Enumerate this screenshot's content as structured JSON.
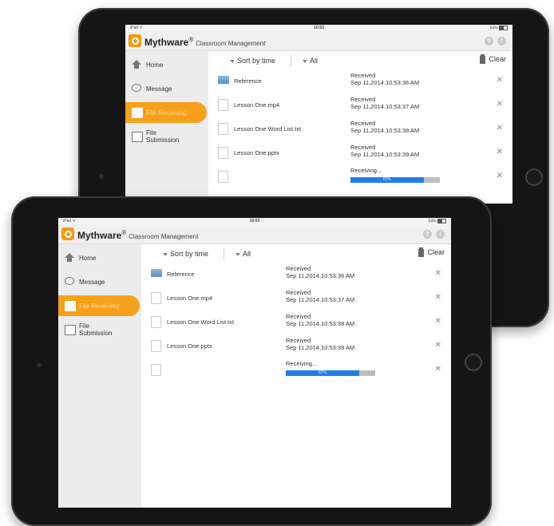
{
  "status_bar": {
    "device": "iPad ᯤ",
    "time": "10:53",
    "battery": "54%"
  },
  "app": {
    "brand": "Mythware",
    "registered": "®",
    "subtitle": "Classroom Management"
  },
  "sidebar": {
    "items": [
      {
        "label": "Home",
        "icon": "house-icon"
      },
      {
        "label": "Message",
        "icon": "speech-bubble-icon"
      },
      {
        "label": "File Receiving",
        "icon": "folder-receive-icon",
        "active": true
      },
      {
        "label": "File\nSubmission",
        "icon": "file-submit-icon"
      }
    ]
  },
  "toolbar": {
    "sort_label": "Sort by time",
    "filter_label": "All",
    "clear_label": "Clear"
  },
  "files": [
    {
      "name": "Reference",
      "status": "Received",
      "time": "Sep 11,2014,10:53:36 AM",
      "type": "folder"
    },
    {
      "name": "Lesson One.mp4",
      "status": "Received",
      "time": "Sep 11,2014,10:53:37 AM",
      "type": "file"
    },
    {
      "name": "Lesson One Word List.txt",
      "status": "Received",
      "time": "Sep 11,2014,10:53:38 AM",
      "type": "file"
    },
    {
      "name": "Lesson One.pptx",
      "status": "Received",
      "time": "Sep 11,2014,10:53:39 AM",
      "type": "file"
    },
    {
      "name": "",
      "status": "Receiving...",
      "progress_label": "82%",
      "progress": 0.82,
      "type": "file"
    }
  ],
  "colors": {
    "accent": "#f7a11a",
    "progress": "#1f7fe6",
    "device": "#151515"
  }
}
